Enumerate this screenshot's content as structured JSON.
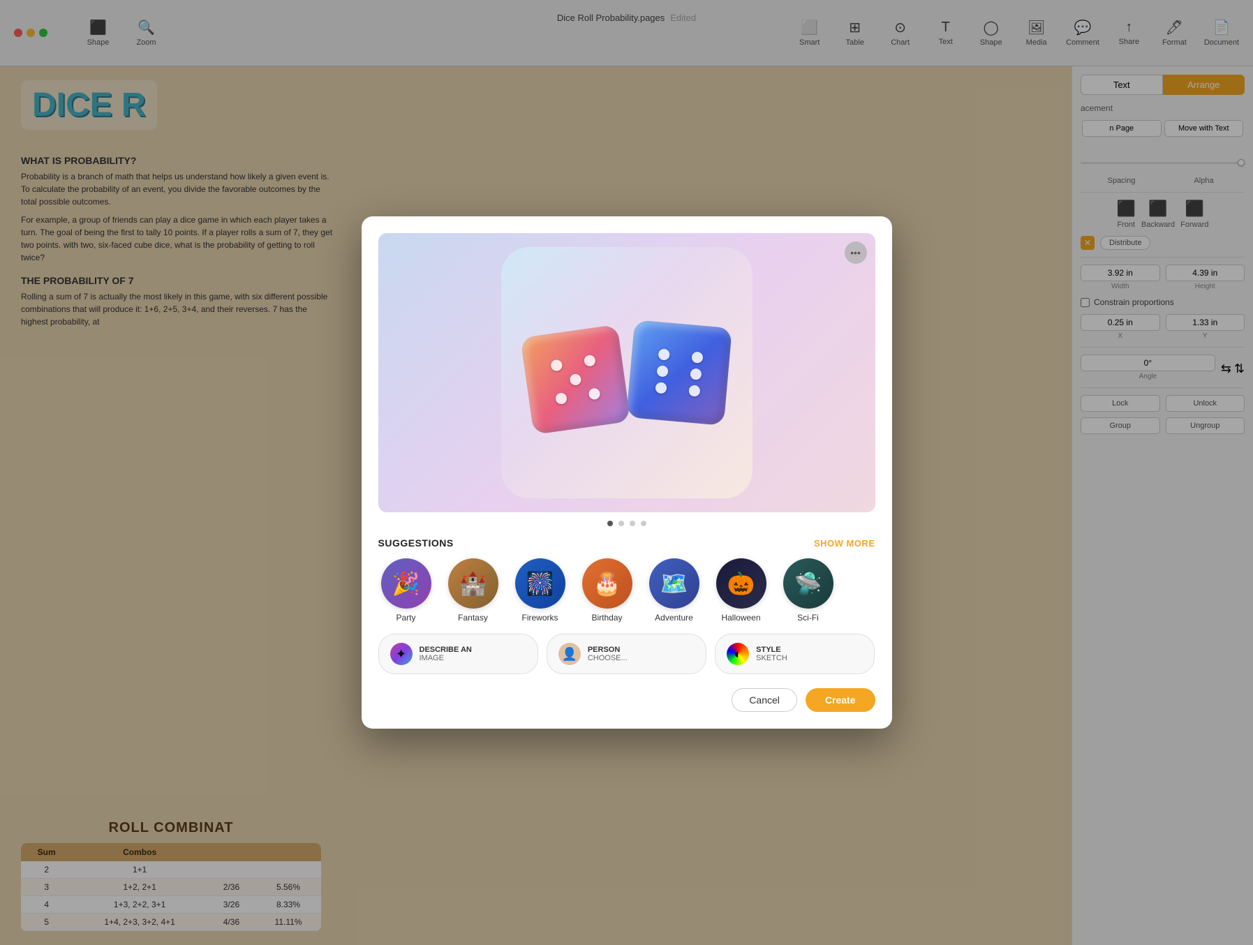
{
  "window": {
    "title": "Dice Roll Probability.pages",
    "subtitle": "Edited"
  },
  "toolbar": {
    "items": [
      {
        "id": "shape",
        "label": "Shape",
        "icon": "⬛"
      },
      {
        "id": "zoom",
        "label": "Zoom",
        "icon": "🔍"
      },
      {
        "id": "smart",
        "label": "Smart",
        "icon": "⬜"
      },
      {
        "id": "table",
        "label": "Table",
        "icon": "⊞"
      },
      {
        "id": "chart",
        "label": "Chart",
        "icon": "⊙"
      },
      {
        "id": "text",
        "label": "Text",
        "icon": "T"
      },
      {
        "id": "shape2",
        "label": "Shape",
        "icon": "◯"
      },
      {
        "id": "media",
        "label": "Media",
        "icon": "⬜"
      },
      {
        "id": "comment",
        "label": "Comment",
        "icon": "💬"
      },
      {
        "id": "share",
        "label": "Share",
        "icon": "↑"
      },
      {
        "id": "format",
        "label": "Format",
        "icon": "🖊"
      },
      {
        "id": "document",
        "label": "Document",
        "icon": "📄"
      }
    ]
  },
  "right_panel": {
    "tabs": [
      "Text",
      "Arrange"
    ],
    "active_tab": "Arrange",
    "placement_section": "acement",
    "placement_buttons": [
      "n Page",
      "Move with Text"
    ],
    "spacing_label": "Spacing",
    "alpha_label": "Alpha",
    "layers": [
      {
        "id": "front",
        "label": "Front",
        "icon": "⬛"
      },
      {
        "id": "backward",
        "label": "Backward",
        "icon": "⬛"
      },
      {
        "id": "forward",
        "label": "Forward",
        "icon": "⬛"
      }
    ],
    "distribute_label": "Distribute",
    "width_label": "Width",
    "height_label": "Height",
    "width_value": "3.92 in",
    "height_value": "4.39 in",
    "constrain_proportions": "Constrain proportions",
    "x_label": "X",
    "y_label": "Y",
    "x_value": "0.25 in",
    "y_value": "1.33 in",
    "angle_label": "Angle",
    "angle_value": "0°",
    "flip_label": "Flip",
    "lock_label": "Lock",
    "unlock_label": "Unlock",
    "group_label": "Group",
    "ungroup_label": "Ungroup"
  },
  "document": {
    "title": "DICE R",
    "what_is_section": "WHAT IS PROBABILITY?",
    "what_is_text1": "Probability is a branch of math that helps us understand how likely a given event is. To calculate the probability of an event, you divide the favorable outcomes by the total possible outcomes.",
    "what_is_text2": "For example, a group of friends can play a dice game in which each player takes a turn. The goal of being the first to tally 10 points. If a player rolls a sum of 7, they get two points. with two, six-faced cube dice, what is the probability of getting to roll twice?",
    "prob_section": "THE PROBABILITY OF 7",
    "prob_text": "Rolling a sum of 7 is actually the most likely in this game, with six different possible combinations that will produce it: 1+6, 2+5, 3+4, and their reverses. 7 has the highest probability, at",
    "table_title": "ROLL COMBINAT",
    "table_headers": [
      "Sum",
      "Combos",
      "",
      ""
    ],
    "table_rows": [
      {
        "sum": "2",
        "combos": "1+1",
        "col3": "",
        "col4": ""
      },
      {
        "sum": "3",
        "combos": "1+2, 2+1",
        "col3": "2/36",
        "col4": "5.56%"
      },
      {
        "sum": "4",
        "combos": "1+3, 2+2, 3+1",
        "col3": "3/26",
        "col4": "8.33%"
      },
      {
        "sum": "5",
        "combos": "1+4, 2+3, 3+2, 4+1",
        "col3": "4/36",
        "col4": "11.11%"
      }
    ]
  },
  "modal": {
    "more_button_label": "•••",
    "dots": [
      true,
      false,
      false,
      false
    ],
    "suggestions_title": "SUGGESTIONS",
    "show_more_label": "SHOW MORE",
    "suggestion_items": [
      {
        "id": "party",
        "label": "Party",
        "emoji": "🎉"
      },
      {
        "id": "fantasy",
        "label": "Fantasy",
        "emoji": "🏰"
      },
      {
        "id": "fireworks",
        "label": "Fireworks",
        "emoji": "🎆"
      },
      {
        "id": "birthday",
        "label": "Birthday",
        "emoji": "🎂"
      },
      {
        "id": "adventure",
        "label": "Adventure",
        "emoji": "🗺️"
      },
      {
        "id": "halloween",
        "label": "Halloween",
        "emoji": "🎃"
      },
      {
        "id": "scifi",
        "label": "Sci-Fi",
        "emoji": "🛸"
      }
    ],
    "bottom_options": [
      {
        "id": "describe",
        "main": "DESCRIBE AN",
        "sub": "IMAGE",
        "icon_class": "boi-describe",
        "icon": "✦"
      },
      {
        "id": "person",
        "main": "PERSON",
        "sub": "CHOOSE...",
        "icon_class": "boi-person",
        "icon": "👤"
      },
      {
        "id": "style",
        "main": "STYLE",
        "sub": "SKETCH",
        "icon_class": "boi-style",
        "icon": "◐"
      }
    ],
    "cancel_label": "Cancel",
    "create_label": "Create"
  }
}
